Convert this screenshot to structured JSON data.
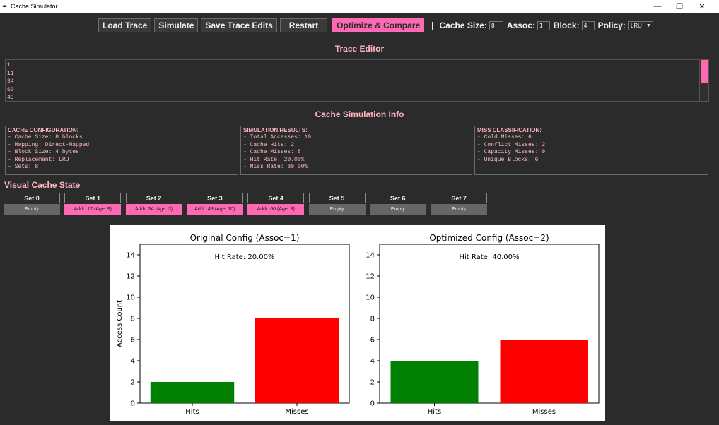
{
  "window": {
    "title": "Cache Simulator",
    "icon": "feather-icon"
  },
  "toolbar": {
    "load_trace": "Load Trace",
    "simulate": "Simulate",
    "save_trace_edits": "Save Trace Edits",
    "restart": "Restart",
    "optimize_compare": "Optimize & Compare",
    "separator": "|",
    "cache_size_label": "Cache Size:",
    "cache_size_value": "8",
    "assoc_label": "Assoc:",
    "assoc_value": "1",
    "block_label": "Block:",
    "block_value": "4",
    "policy_label": "Policy:",
    "policy_value": "LRU"
  },
  "trace_editor": {
    "title": "Trace Editor",
    "lines": [
      "1",
      "11",
      "34",
      "60",
      "43"
    ]
  },
  "sim_info": {
    "title": "Cache Simulation Info",
    "config": {
      "heading": "CACHE CONFIGURATION:",
      "lines": [
        "- Cache Size: 8 blocks",
        "- Mapping: Direct-Mapped",
        "- Block Size: 4 bytes",
        "- Replacement: LRU",
        "- Sets: 8"
      ]
    },
    "results": {
      "heading": "SIMULATION RESULTS:",
      "lines": [
        "- Total Accesses: 10",
        "- Cache Hits: 2",
        "- Cache Misses: 8",
        "- Hit Rate: 20.00%",
        "- Miss Rate: 80.00%"
      ]
    },
    "miss": {
      "heading": "MISS CLASSIFICATION:",
      "lines": [
        "- Cold Misses: 6",
        "- Conflict Misses: 2",
        "- Capacity Misses: 0",
        "- Unique Blocks: 6"
      ]
    }
  },
  "visual_cache": {
    "title": "Visual Cache State",
    "sets": [
      {
        "name": "Set 0",
        "content": "Empty",
        "filled": false
      },
      {
        "name": "Set 1",
        "content": "Addr: 17 (Age: 9)",
        "filled": true
      },
      {
        "name": "Set 2",
        "content": "Addr: 34 (Age: 3)",
        "filled": true
      },
      {
        "name": "Set 3",
        "content": "Addr: 43 (Age: 10)",
        "filled": true
      },
      {
        "name": "Set 4",
        "content": "Addr: 60 (Age: 8)",
        "filled": true
      },
      {
        "name": "Set 5",
        "content": "Empty",
        "filled": false
      },
      {
        "name": "Set 6",
        "content": "Empty",
        "filled": false
      },
      {
        "name": "Set 7",
        "content": "Empty",
        "filled": false
      }
    ]
  },
  "colors": {
    "accent": "#ff69b4",
    "label_pink": "#ffb6c1",
    "background": "#2b2b2b",
    "hits": "#008000",
    "misses": "#ff0000"
  },
  "chart_data": [
    {
      "type": "bar",
      "title": "Original Config (Assoc=1)",
      "annotation": "Hit Rate: 20.00%",
      "categories": [
        "Hits",
        "Misses"
      ],
      "values": [
        2,
        8
      ],
      "colors": [
        "#008000",
        "#ff0000"
      ],
      "ylabel": "Access Count",
      "ylim": [
        0,
        15
      ],
      "yticks": [
        0,
        2,
        4,
        6,
        8,
        10,
        12,
        14
      ],
      "grid": false
    },
    {
      "type": "bar",
      "title": "Optimized Config (Assoc=2)",
      "annotation": "Hit Rate: 40.00%",
      "categories": [
        "Hits",
        "Misses"
      ],
      "values": [
        4,
        6
      ],
      "colors": [
        "#008000",
        "#ff0000"
      ],
      "ylabel": "",
      "ylim": [
        0,
        15
      ],
      "yticks": [
        0,
        2,
        4,
        6,
        8,
        10,
        12,
        14
      ],
      "grid": false
    }
  ]
}
